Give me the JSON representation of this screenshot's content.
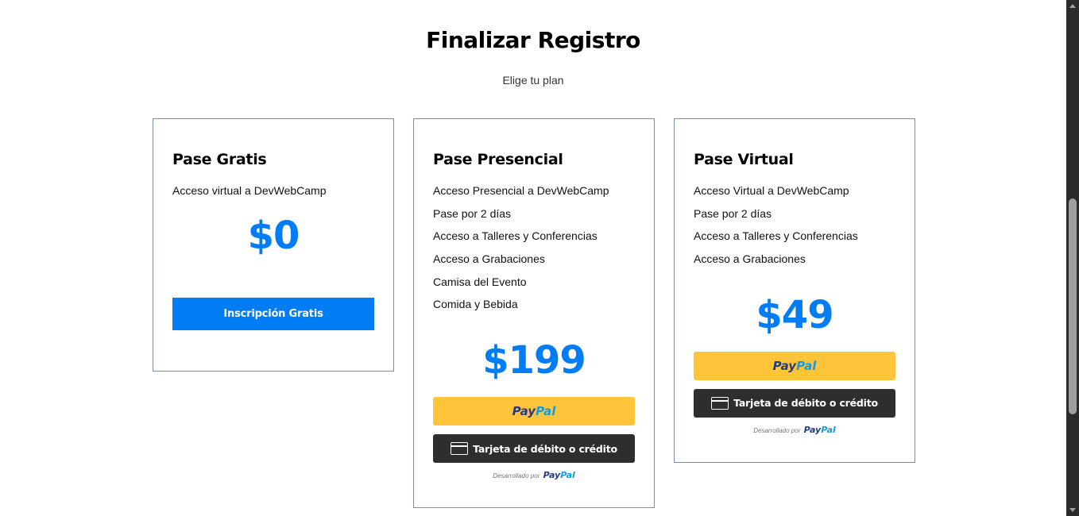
{
  "header": {
    "title": "Finalizar Registro",
    "subtitle": "Elige tu plan"
  },
  "plans": [
    {
      "name": "Pase Gratis",
      "features": [
        "Acceso virtual a DevWebCamp"
      ],
      "price": "$0",
      "button_label": "Inscripción Gratis"
    },
    {
      "name": "Pase Presencial",
      "features": [
        "Acceso Presencial a DevWebCamp",
        "Pase por 2 días",
        "Acceso a Talleres y Conferencias",
        "Acceso a Grabaciones",
        "Camisa del Evento",
        "Comida y Bebida"
      ],
      "price": "$199"
    },
    {
      "name": "Pase Virtual",
      "features": [
        "Acceso Virtual a DevWebCamp",
        "Pase por 2 días",
        "Acceso a Talleres y Conferencias",
        "Acceso a Grabaciones"
      ],
      "price": "$49"
    }
  ],
  "paypal": {
    "logo_pay": "Pay",
    "logo_pal": "Pal",
    "card_button_label": "Tarjeta de débito o crédito",
    "powered_by": "Desarrollado por"
  },
  "colors": {
    "accent": "#007df4",
    "paypal_yellow": "#ffc439",
    "card_dark": "#2c2e2f",
    "border": "#7c8ca3"
  }
}
